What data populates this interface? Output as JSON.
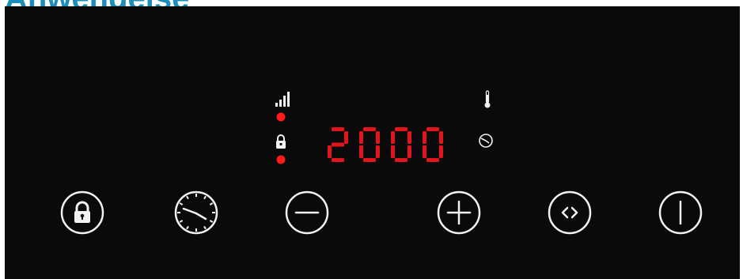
{
  "page": {
    "heading": "Anwendeise"
  },
  "panel": {
    "background": "#0a0a0a",
    "icon_color": "#f2f2f2",
    "led_color": "#ff1a1a"
  },
  "display": {
    "value": "2000",
    "digit_color": "#e3141c"
  },
  "indicators": {
    "power_level_icon": "signal-bars-icon",
    "lock_icon": "padlock-icon",
    "temperature_icon": "thermometer-icon",
    "timer_icon": "clock-icon",
    "power_led_on": true,
    "lock_led_on": true
  },
  "controls": [
    {
      "id": "lock",
      "icon": "padlock-icon"
    },
    {
      "id": "timer",
      "icon": "clock-icon"
    },
    {
      "id": "minus",
      "icon": "minus-icon"
    },
    {
      "id": "plus",
      "icon": "plus-icon"
    },
    {
      "id": "mode",
      "icon": "chevrons-icon"
    },
    {
      "id": "power",
      "icon": "power-icon"
    }
  ]
}
